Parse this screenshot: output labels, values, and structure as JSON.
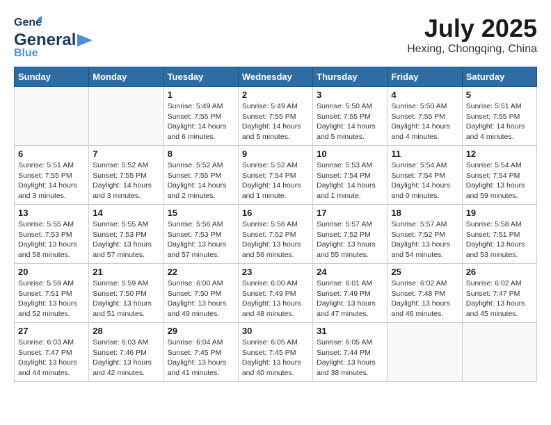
{
  "header": {
    "logo_general": "General",
    "logo_blue": "Blue",
    "month": "July 2025",
    "location": "Hexing, Chongqing, China"
  },
  "weekdays": [
    "Sunday",
    "Monday",
    "Tuesday",
    "Wednesday",
    "Thursday",
    "Friday",
    "Saturday"
  ],
  "weeks": [
    [
      {
        "day": "",
        "info": ""
      },
      {
        "day": "",
        "info": ""
      },
      {
        "day": "1",
        "info": "Sunrise: 5:49 AM\nSunset: 7:55 PM\nDaylight: 14 hours\nand 6 minutes."
      },
      {
        "day": "2",
        "info": "Sunrise: 5:49 AM\nSunset: 7:55 PM\nDaylight: 14 hours\nand 5 minutes."
      },
      {
        "day": "3",
        "info": "Sunrise: 5:50 AM\nSunset: 7:55 PM\nDaylight: 14 hours\nand 5 minutes."
      },
      {
        "day": "4",
        "info": "Sunrise: 5:50 AM\nSunset: 7:55 PM\nDaylight: 14 hours\nand 4 minutes."
      },
      {
        "day": "5",
        "info": "Sunrise: 5:51 AM\nSunset: 7:55 PM\nDaylight: 14 hours\nand 4 minutes."
      }
    ],
    [
      {
        "day": "6",
        "info": "Sunrise: 5:51 AM\nSunset: 7:55 PM\nDaylight: 14 hours\nand 3 minutes."
      },
      {
        "day": "7",
        "info": "Sunrise: 5:52 AM\nSunset: 7:55 PM\nDaylight: 14 hours\nand 3 minutes."
      },
      {
        "day": "8",
        "info": "Sunrise: 5:52 AM\nSunset: 7:55 PM\nDaylight: 14 hours\nand 2 minutes."
      },
      {
        "day": "9",
        "info": "Sunrise: 5:52 AM\nSunset: 7:54 PM\nDaylight: 14 hours\nand 1 minute."
      },
      {
        "day": "10",
        "info": "Sunrise: 5:53 AM\nSunset: 7:54 PM\nDaylight: 14 hours\nand 1 minute."
      },
      {
        "day": "11",
        "info": "Sunrise: 5:54 AM\nSunset: 7:54 PM\nDaylight: 14 hours\nand 0 minutes."
      },
      {
        "day": "12",
        "info": "Sunrise: 5:54 AM\nSunset: 7:54 PM\nDaylight: 13 hours\nand 59 minutes."
      }
    ],
    [
      {
        "day": "13",
        "info": "Sunrise: 5:55 AM\nSunset: 7:53 PM\nDaylight: 13 hours\nand 58 minutes."
      },
      {
        "day": "14",
        "info": "Sunrise: 5:55 AM\nSunset: 7:53 PM\nDaylight: 13 hours\nand 57 minutes."
      },
      {
        "day": "15",
        "info": "Sunrise: 5:56 AM\nSunset: 7:53 PM\nDaylight: 13 hours\nand 57 minutes."
      },
      {
        "day": "16",
        "info": "Sunrise: 5:56 AM\nSunset: 7:52 PM\nDaylight: 13 hours\nand 56 minutes."
      },
      {
        "day": "17",
        "info": "Sunrise: 5:57 AM\nSunset: 7:52 PM\nDaylight: 13 hours\nand 55 minutes."
      },
      {
        "day": "18",
        "info": "Sunrise: 5:57 AM\nSunset: 7:52 PM\nDaylight: 13 hours\nand 54 minutes."
      },
      {
        "day": "19",
        "info": "Sunrise: 5:58 AM\nSunset: 7:51 PM\nDaylight: 13 hours\nand 53 minutes."
      }
    ],
    [
      {
        "day": "20",
        "info": "Sunrise: 5:59 AM\nSunset: 7:51 PM\nDaylight: 13 hours\nand 52 minutes."
      },
      {
        "day": "21",
        "info": "Sunrise: 5:59 AM\nSunset: 7:50 PM\nDaylight: 13 hours\nand 51 minutes."
      },
      {
        "day": "22",
        "info": "Sunrise: 6:00 AM\nSunset: 7:50 PM\nDaylight: 13 hours\nand 49 minutes."
      },
      {
        "day": "23",
        "info": "Sunrise: 6:00 AM\nSunset: 7:49 PM\nDaylight: 13 hours\nand 48 minutes."
      },
      {
        "day": "24",
        "info": "Sunrise: 6:01 AM\nSunset: 7:49 PM\nDaylight: 13 hours\nand 47 minutes."
      },
      {
        "day": "25",
        "info": "Sunrise: 6:02 AM\nSunset: 7:48 PM\nDaylight: 13 hours\nand 46 minutes."
      },
      {
        "day": "26",
        "info": "Sunrise: 6:02 AM\nSunset: 7:47 PM\nDaylight: 13 hours\nand 45 minutes."
      }
    ],
    [
      {
        "day": "27",
        "info": "Sunrise: 6:03 AM\nSunset: 7:47 PM\nDaylight: 13 hours\nand 44 minutes."
      },
      {
        "day": "28",
        "info": "Sunrise: 6:03 AM\nSunset: 7:46 PM\nDaylight: 13 hours\nand 42 minutes."
      },
      {
        "day": "29",
        "info": "Sunrise: 6:04 AM\nSunset: 7:45 PM\nDaylight: 13 hours\nand 41 minutes."
      },
      {
        "day": "30",
        "info": "Sunrise: 6:05 AM\nSunset: 7:45 PM\nDaylight: 13 hours\nand 40 minutes."
      },
      {
        "day": "31",
        "info": "Sunrise: 6:05 AM\nSunset: 7:44 PM\nDaylight: 13 hours\nand 38 minutes."
      },
      {
        "day": "",
        "info": ""
      },
      {
        "day": "",
        "info": ""
      }
    ]
  ]
}
